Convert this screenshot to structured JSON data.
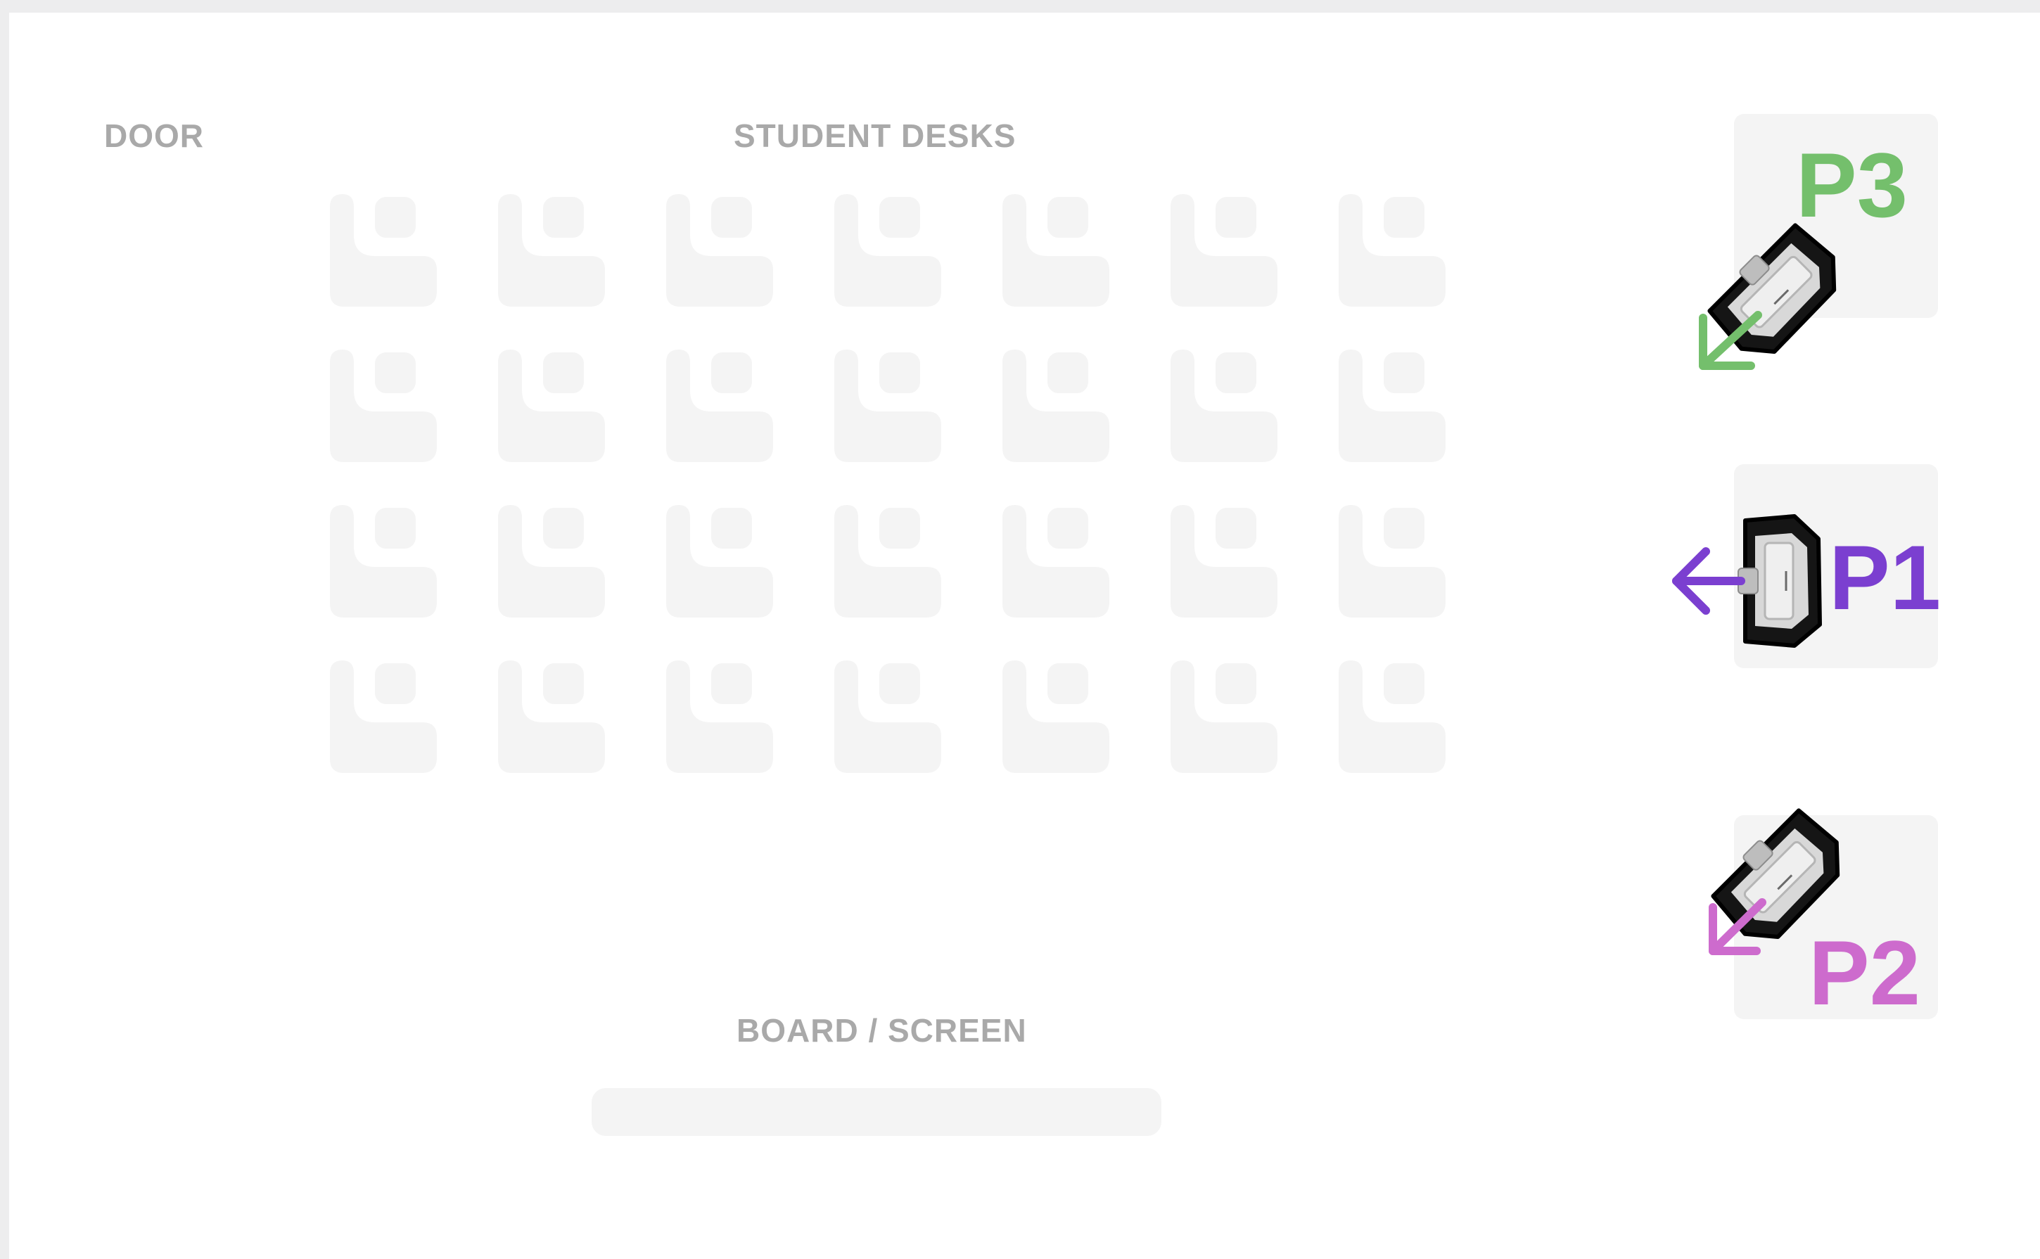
{
  "labels": {
    "door": "DOOR",
    "student_desks": "STUDENT DESKS",
    "board": "BOARD / SCREEN"
  },
  "desk_grid": {
    "rows": 4,
    "columns": 7
  },
  "projectors": [
    {
      "id": "P3",
      "label": "P3",
      "color": "#74bf6c",
      "arrow": "down-left"
    },
    {
      "id": "P1",
      "label": "P1",
      "color": "#7b3fd0",
      "arrow": "left"
    },
    {
      "id": "P2",
      "label": "P2",
      "color": "#cd6bcd",
      "arrow": "down-left"
    }
  ],
  "colors": {
    "label_gray": "#a9a9a9",
    "desk_fill": "#f4f4f4",
    "device_frame": "#111111",
    "device_body": "#d9d9d9"
  }
}
